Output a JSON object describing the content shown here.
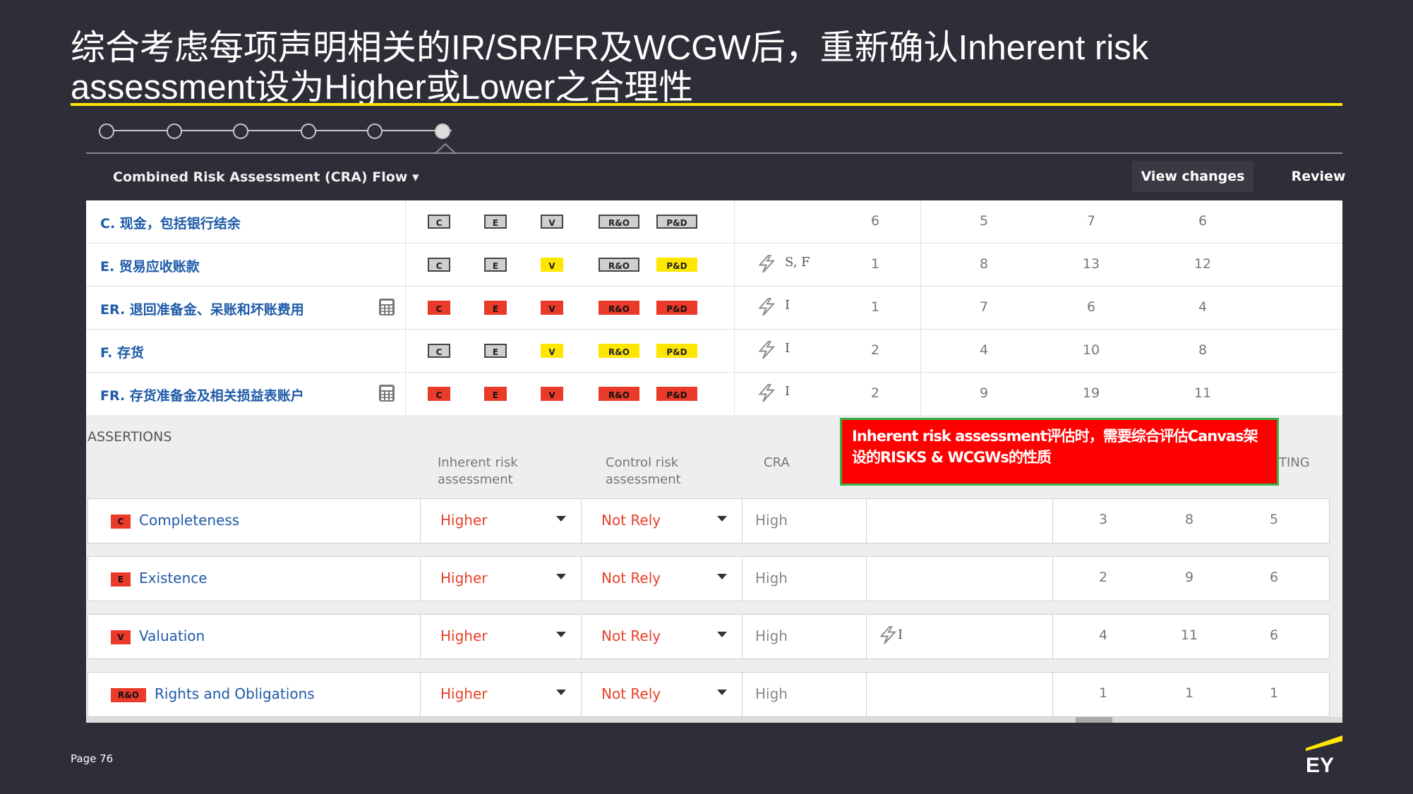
{
  "slide": {
    "title": "综合考虑每项声明相关的IR/SR/FR及WCGW后，重新确认Inherent risk assessment设为Higher或Lower之合理性",
    "page_label": "Page 76",
    "logo_text": "EY"
  },
  "toolbar": {
    "flow_title": "Combined Risk Assessment (CRA) Flow ▾",
    "view_changes": "View changes",
    "review": "Review"
  },
  "accounts": [
    {
      "name": "C. 现金，包括银行结余",
      "has_calc": false,
      "badges": [
        {
          "label": "C",
          "color": "grey"
        },
        {
          "label": "E",
          "color": "grey"
        },
        {
          "label": "V",
          "color": "grey"
        },
        {
          "label": "R&O",
          "color": "grey"
        },
        {
          "label": "P&D",
          "color": "grey"
        }
      ],
      "risk": "",
      "nums": [
        "6",
        "5",
        "7",
        "6"
      ]
    },
    {
      "name": "E. 贸易应收账款",
      "has_calc": false,
      "badges": [
        {
          "label": "C",
          "color": "grey"
        },
        {
          "label": "E",
          "color": "grey"
        },
        {
          "label": "V",
          "color": "yellow"
        },
        {
          "label": "R&O",
          "color": "grey"
        },
        {
          "label": "P&D",
          "color": "yellow"
        }
      ],
      "risk": "S,  F",
      "nums": [
        "1",
        "8",
        "13",
        "12"
      ]
    },
    {
      "name": "ER. 退回准备金、呆账和坏账费用",
      "has_calc": true,
      "badges": [
        {
          "label": "C",
          "color": "red"
        },
        {
          "label": "E",
          "color": "red"
        },
        {
          "label": "V",
          "color": "red"
        },
        {
          "label": "R&O",
          "color": "red"
        },
        {
          "label": "P&D",
          "color": "red"
        }
      ],
      "risk": "I",
      "nums": [
        "1",
        "7",
        "6",
        "4"
      ]
    },
    {
      "name": "F. 存货",
      "has_calc": false,
      "badges": [
        {
          "label": "C",
          "color": "grey"
        },
        {
          "label": "E",
          "color": "grey"
        },
        {
          "label": "V",
          "color": "yellow"
        },
        {
          "label": "R&O",
          "color": "yellow"
        },
        {
          "label": "P&D",
          "color": "yellow"
        }
      ],
      "risk": "I",
      "nums": [
        "2",
        "4",
        "10",
        "8"
      ]
    },
    {
      "name": "FR. 存货准备金及相关损益表账户",
      "has_calc": true,
      "badges": [
        {
          "label": "C",
          "color": "red"
        },
        {
          "label": "E",
          "color": "red"
        },
        {
          "label": "V",
          "color": "red"
        },
        {
          "label": "R&O",
          "color": "red"
        },
        {
          "label": "P&D",
          "color": "red"
        }
      ],
      "risk": "I",
      "nums": [
        "2",
        "9",
        "19",
        "11"
      ]
    }
  ],
  "assertions": {
    "title": "ASSERTIONS",
    "headers": {
      "inherent": "Inherent risk assessment",
      "control": "Control risk assessment",
      "cra": "CRA",
      "testing": "TING"
    },
    "rows": [
      {
        "badge": "C",
        "name": "Completeness",
        "inherent": "Higher",
        "control": "Not Rely",
        "cra": "High",
        "risk": "",
        "nums": [
          "3",
          "8",
          "5"
        ]
      },
      {
        "badge": "E",
        "name": "Existence",
        "inherent": "Higher",
        "control": "Not Rely",
        "cra": "High",
        "risk": "",
        "nums": [
          "2",
          "9",
          "6"
        ]
      },
      {
        "badge": "V",
        "name": "Valuation",
        "inherent": "Higher",
        "control": "Not Rely",
        "cra": "High",
        "risk": "I",
        "nums": [
          "4",
          "11",
          "6"
        ]
      },
      {
        "badge": "R&O",
        "name": "Rights and Obligations",
        "inherent": "Higher",
        "control": "Not Rely",
        "cra": "High",
        "risk": "",
        "nums": [
          "1",
          "1",
          "1"
        ]
      }
    ]
  },
  "callout": {
    "text": "Inherent risk assessment评估时，需要综合评估Canvas架设的RISKS & WCGWs的性质"
  },
  "colors": {
    "background": "#2e2e38",
    "accent_yellow": "#ffe600",
    "badge_red": "#ea3a2a",
    "link_blue": "#1e5aa8",
    "callout_red": "#ff0000",
    "callout_border": "#35b24a"
  }
}
